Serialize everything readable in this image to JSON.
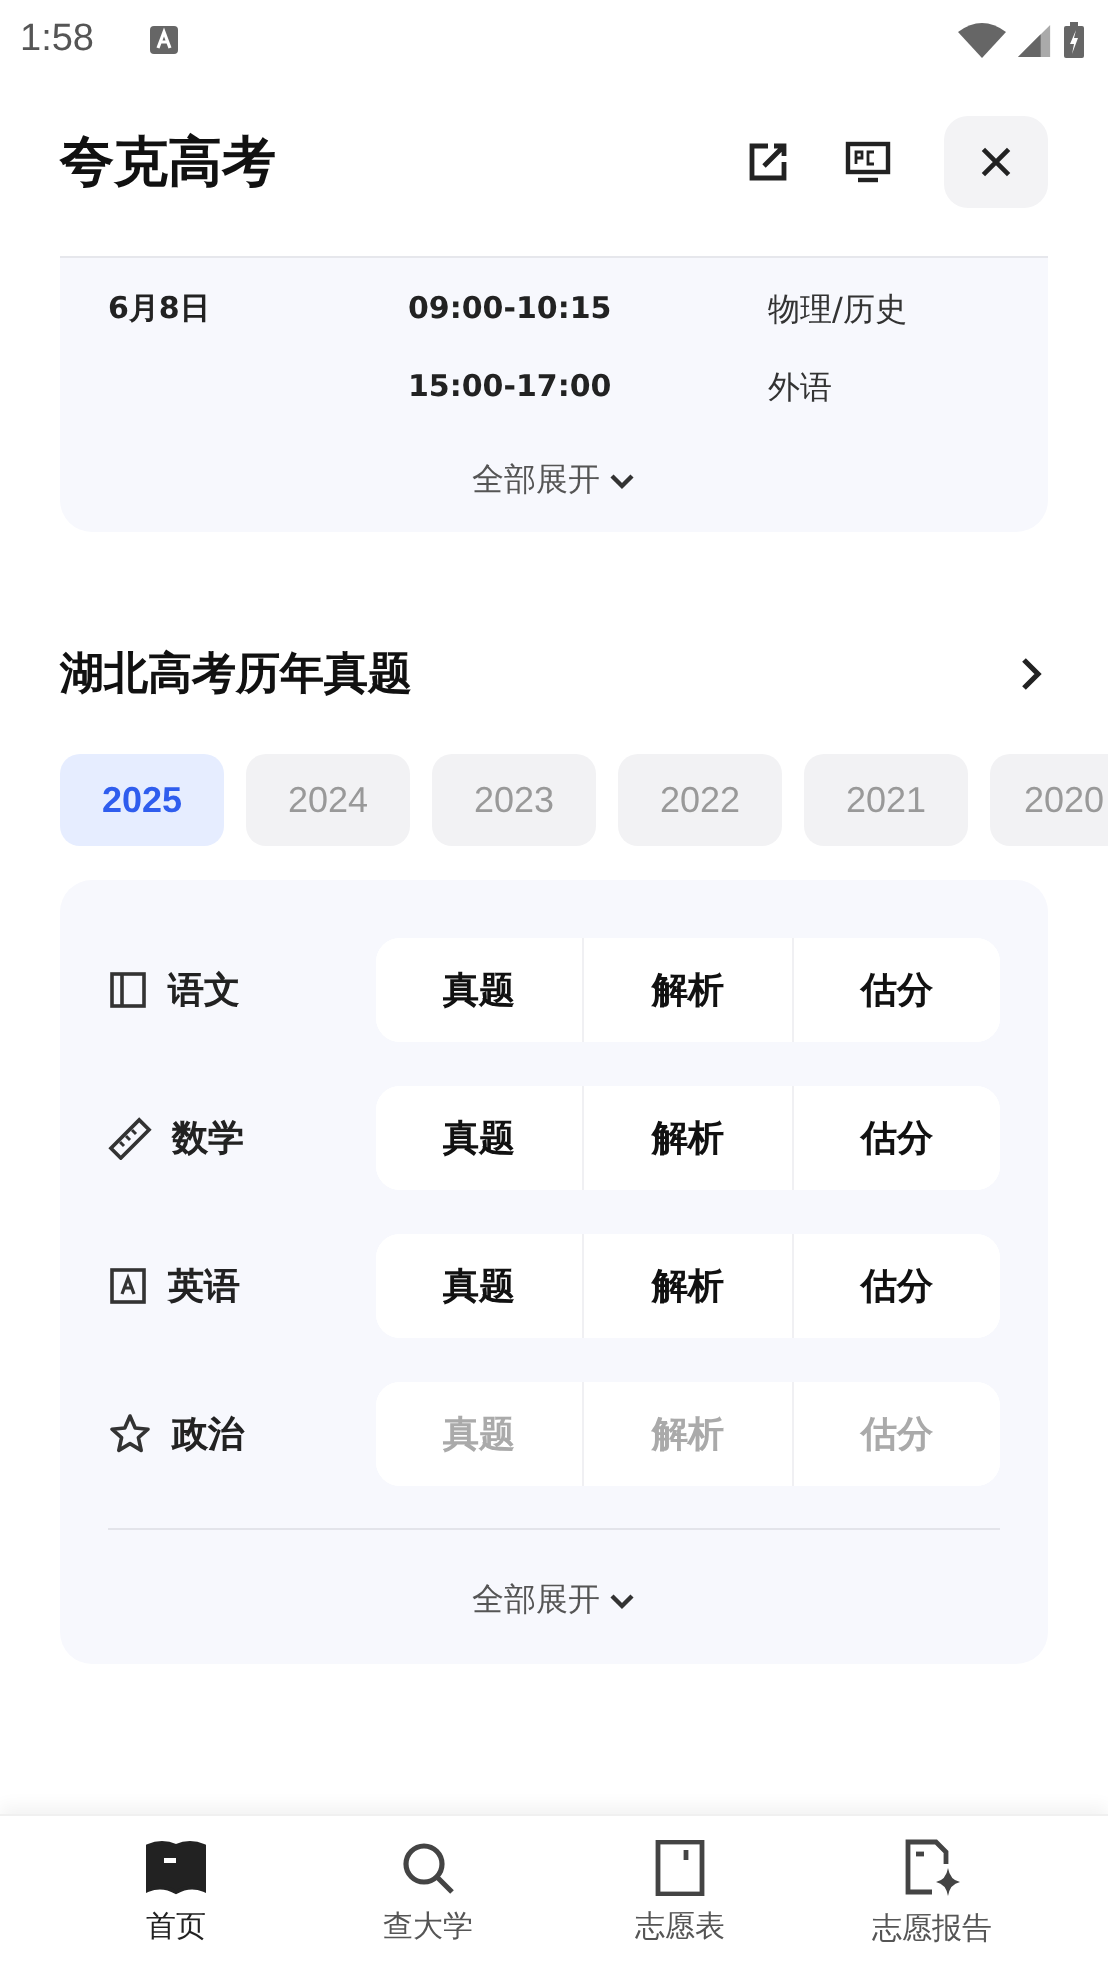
{
  "status_bar": {
    "time": "1:58"
  },
  "header": {
    "title": "夸克高考"
  },
  "schedule": {
    "rows": [
      {
        "date": "6月8日",
        "slots": [
          {
            "time": "09:00-10:15",
            "subject": "物理/历史"
          },
          {
            "time": "15:00-17:00",
            "subject": "外语"
          }
        ]
      }
    ],
    "expand": "全部展开"
  },
  "papers": {
    "title": "湖北高考历年真题",
    "years": [
      {
        "label": "2025",
        "selected": true
      },
      {
        "label": "2024",
        "selected": false
      },
      {
        "label": "2023",
        "selected": false
      },
      {
        "label": "2022",
        "selected": false
      },
      {
        "label": "2021",
        "selected": false
      },
      {
        "label": "2020",
        "selected": false
      }
    ],
    "subjects": [
      {
        "kind": "book",
        "name": "语文",
        "disabled": false,
        "actions": [
          "真题",
          "解析",
          "估分"
        ]
      },
      {
        "kind": "ruler",
        "name": "数学",
        "disabled": false,
        "actions": [
          "真题",
          "解析",
          "估分"
        ]
      },
      {
        "kind": "letter",
        "name": "英语",
        "disabled": false,
        "actions": [
          "真题",
          "解析",
          "估分"
        ]
      },
      {
        "kind": "star",
        "name": "政治",
        "disabled": true,
        "actions": [
          "真题",
          "解析",
          "估分"
        ]
      }
    ],
    "expand": "全部展开"
  },
  "nav": [
    {
      "kind": "home",
      "label": "首页",
      "selected": true
    },
    {
      "kind": "search",
      "label": "查大学",
      "selected": false
    },
    {
      "kind": "form",
      "label": "志愿表",
      "selected": false
    },
    {
      "kind": "report",
      "label": "志愿报告",
      "selected": false
    }
  ]
}
